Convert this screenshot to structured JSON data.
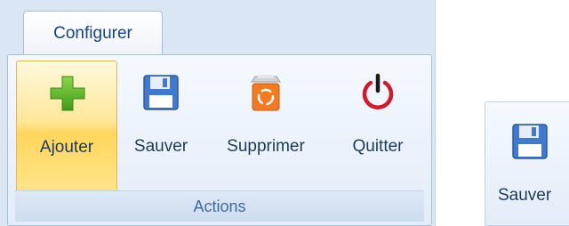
{
  "ribbon": {
    "tabs": [
      {
        "label": "Configurer",
        "selected": true
      }
    ],
    "groups": [
      {
        "label": "Actions",
        "buttons": [
          {
            "label": "Ajouter",
            "icon": "plus-icon",
            "state": "hover"
          },
          {
            "label": "Sauver",
            "icon": "floppy-disk-icon"
          },
          {
            "label": "Supprimer",
            "icon": "recycle-bin-icon"
          },
          {
            "label": "Quitter",
            "icon": "power-icon"
          }
        ]
      }
    ]
  },
  "collapsed_ribbon": {
    "button": {
      "label": "Sauver",
      "icon": "floppy-disk-icon"
    }
  },
  "colors": {
    "tab_text": "#15428b",
    "group_label": "#3e6aa4",
    "button_text": "#1e395b",
    "hover_highlight": "#ffd65c",
    "plus_green": "#5cb82a",
    "recycle_orange": "#f47a1f",
    "power_red": "#d2192b",
    "floppy_blue": "#3f7ad0"
  }
}
